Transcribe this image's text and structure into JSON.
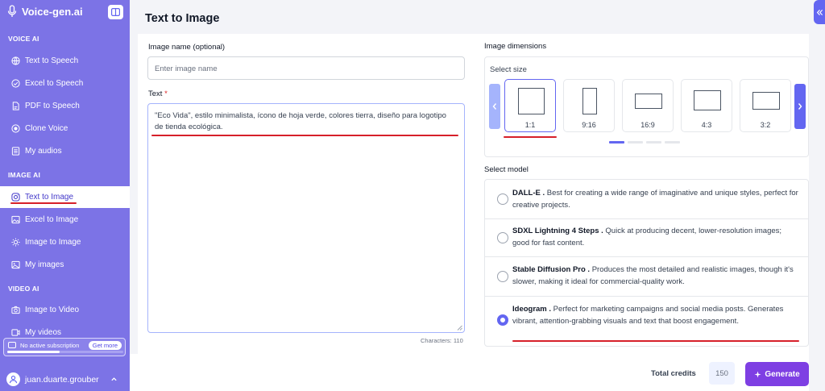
{
  "app": {
    "name": "Voice-gen.ai"
  },
  "sidebar": {
    "sections": [
      {
        "title": "VOICE AI",
        "items": [
          {
            "label": "Text to Speech",
            "icon": "globe-icon"
          },
          {
            "label": "Excel to Speech",
            "icon": "check-circle-icon"
          },
          {
            "label": "PDF to Speech",
            "icon": "pdf-file-icon"
          },
          {
            "label": "Clone Voice",
            "icon": "record-icon"
          },
          {
            "label": "My audios",
            "icon": "list-icon"
          }
        ]
      },
      {
        "title": "IMAGE AI",
        "items": [
          {
            "label": "Text to Image",
            "icon": "instagram-icon",
            "active": true
          },
          {
            "label": "Excel to Image",
            "icon": "image-icon"
          },
          {
            "label": "Image to Image",
            "icon": "sun-icon"
          },
          {
            "label": "My images",
            "icon": "images-icon"
          }
        ]
      },
      {
        "title": "VIDEO AI",
        "items": [
          {
            "label": "Image to Video",
            "icon": "camera-icon"
          },
          {
            "label": "My videos",
            "icon": "video-icon"
          }
        ]
      }
    ],
    "subscription": {
      "text": "No active subscription",
      "button": "Get more",
      "progress": 0.45
    },
    "user": {
      "name": "juan.duarte.grouber"
    }
  },
  "main": {
    "title": "Text to Image",
    "image_name": {
      "label": "Image name (optional)",
      "placeholder": "Enter image name",
      "value": ""
    },
    "text": {
      "label": "Text",
      "required_mark": "*",
      "value": "\"Eco Vida\", estilo minimalista, ícono de hoja verde, colores tierra, diseño para logotipo de tienda ecológica.",
      "characters": "Characters: 110"
    },
    "dimensions": {
      "label": "Image dimensions",
      "select_label": "Select size",
      "options": [
        "1:1",
        "9:16",
        "16:9",
        "4:3",
        "3:2"
      ],
      "selected": "1:1",
      "active_page": 1,
      "pages": 4
    },
    "model": {
      "label": "Select model",
      "options": [
        {
          "name": "DALL-E .",
          "desc": " Best for creating a wide range of imaginative and unique styles, perfect for creative projects.",
          "selected": false
        },
        {
          "name": "SDXL Lightning 4 Steps .",
          "desc": " Quick at producing decent, lower-resolution images; good for fast content.",
          "selected": false
        },
        {
          "name": "Stable Diffusion Pro .",
          "desc": " Produces the most detailed and realistic images, though it's slower, making it ideal for commercial-quality work.",
          "selected": false
        },
        {
          "name": "Ideogram .",
          "desc": " Perfect for marketing campaigns and social media posts. Generates vibrant, attention-grabbing visuals and text that boost engagement.",
          "selected": true
        }
      ]
    },
    "footer": {
      "credits_label": "Total credits",
      "credits_value": "150",
      "generate_label": "Generate"
    }
  },
  "colors": {
    "sidebar": "#7c73e6",
    "accent": "#6366f1",
    "generate": "#7e3fe3",
    "annotation": "#d6202a"
  }
}
